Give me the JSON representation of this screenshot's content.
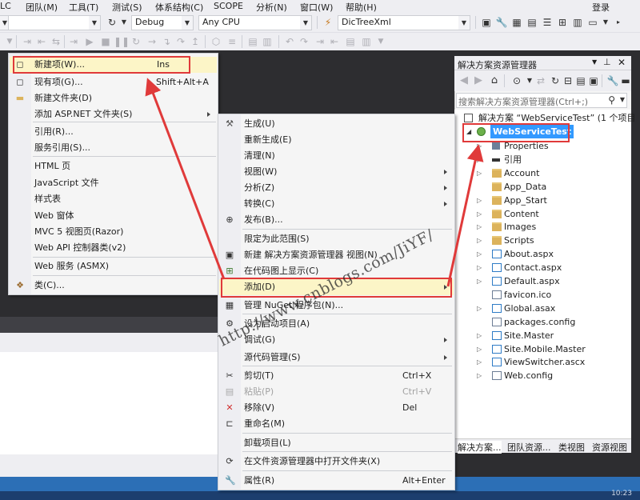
{
  "menubar": {
    "items": [
      "LC",
      "团队(M)",
      "工具(T)",
      "测试(S)",
      "体系结构(C)",
      "SCOPE",
      "分析(N)",
      "窗口(W)",
      "帮助(H)"
    ],
    "signin": "登录"
  },
  "toolbar": {
    "config": "Debug",
    "platform": "Any CPU",
    "startup_target": "DicTreeXml"
  },
  "project_menu": {
    "items": [
      {
        "label": "新建项(W)...",
        "shortcut": "Ins",
        "icon": "new-item-icon"
      },
      {
        "label": "现有项(G)...",
        "shortcut": "Shift+Alt+A",
        "icon": "existing-item-icon"
      },
      {
        "label": "新建文件夹(D)",
        "shortcut": "",
        "icon": "new-folder-icon"
      },
      {
        "label": "添加 ASP.NET 文件夹(S)",
        "shortcut": "",
        "icon": ""
      },
      {
        "label": "引用(R)...",
        "shortcut": "",
        "icon": ""
      },
      {
        "label": "服务引用(S)...",
        "shortcut": "",
        "icon": ""
      },
      {
        "label": "HTML 页",
        "shortcut": "",
        "icon": ""
      },
      {
        "label": "JavaScript 文件",
        "shortcut": "",
        "icon": ""
      },
      {
        "label": "样式表",
        "shortcut": "",
        "icon": ""
      },
      {
        "label": "Web 窗体",
        "shortcut": "",
        "icon": ""
      },
      {
        "label": "MVC 5 视图页(Razor)",
        "shortcut": "",
        "icon": ""
      },
      {
        "label": "Web API 控制器类(v2)",
        "shortcut": "",
        "icon": ""
      },
      {
        "label": "Web 服务 (ASMX)",
        "shortcut": "",
        "icon": ""
      },
      {
        "label": "类(C)...",
        "shortcut": "",
        "icon": "class-icon"
      }
    ]
  },
  "context_menu": {
    "items": [
      {
        "label": "生成(U)",
        "shortcut": ""
      },
      {
        "label": "重新生成(E)",
        "shortcut": ""
      },
      {
        "label": "清理(N)",
        "shortcut": ""
      },
      {
        "label": "视图(W)",
        "shortcut": ""
      },
      {
        "label": "分析(Z)",
        "shortcut": ""
      },
      {
        "label": "转换(C)",
        "shortcut": ""
      },
      {
        "label": "发布(B)...",
        "shortcut": ""
      },
      {
        "label": "限定为此范围(S)",
        "shortcut": ""
      },
      {
        "label": "新建 解决方案资源管理器 视图(N)",
        "shortcut": ""
      },
      {
        "label": "在代码图上显示(C)",
        "shortcut": ""
      },
      {
        "label": "添加(D)",
        "shortcut": ""
      },
      {
        "label": "管理 NuGet 程序包(N)...",
        "shortcut": ""
      },
      {
        "label": "设为启动项目(A)",
        "shortcut": ""
      },
      {
        "label": "调试(G)",
        "shortcut": ""
      },
      {
        "label": "源代码管理(S)",
        "shortcut": ""
      },
      {
        "label": "剪切(T)",
        "shortcut": "Ctrl+X"
      },
      {
        "label": "粘贴(P)",
        "shortcut": "Ctrl+V"
      },
      {
        "label": "移除(V)",
        "shortcut": "Del"
      },
      {
        "label": "重命名(M)",
        "shortcut": ""
      },
      {
        "label": "卸载项目(L)",
        "shortcut": ""
      },
      {
        "label": "在文件资源管理器中打开文件夹(X)",
        "shortcut": ""
      },
      {
        "label": "属性(R)",
        "shortcut": "Alt+Enter"
      }
    ]
  },
  "solution_explorer": {
    "title": "解决方案资源管理器",
    "search_placeholder": "搜索解决方案资源管理器(Ctrl+;)",
    "solution_label": "解决方案 “WebServiceTest” (1 个项目",
    "project": "WebServiceTest",
    "items": [
      {
        "label": "Properties",
        "kind": "props",
        "expandable": true
      },
      {
        "label": "引用",
        "kind": "refs",
        "expandable": true
      },
      {
        "label": "Account",
        "kind": "folder",
        "expandable": true
      },
      {
        "label": "App_Data",
        "kind": "folder",
        "expandable": false
      },
      {
        "label": "App_Start",
        "kind": "folder",
        "expandable": true
      },
      {
        "label": "Content",
        "kind": "folder",
        "expandable": true
      },
      {
        "label": "Images",
        "kind": "folder",
        "expandable": true
      },
      {
        "label": "Scripts",
        "kind": "folder",
        "expandable": true
      },
      {
        "label": "About.aspx",
        "kind": "page",
        "expandable": true
      },
      {
        "label": "Contact.aspx",
        "kind": "page",
        "expandable": true
      },
      {
        "label": "Default.aspx",
        "kind": "page",
        "expandable": true
      },
      {
        "label": "favicon.ico",
        "kind": "file",
        "expandable": false
      },
      {
        "label": "Global.asax",
        "kind": "page",
        "expandable": true
      },
      {
        "label": "packages.config",
        "kind": "file",
        "expandable": false
      },
      {
        "label": "Site.Master",
        "kind": "page",
        "expandable": true
      },
      {
        "label": "Site.Mobile.Master",
        "kind": "page",
        "expandable": true
      },
      {
        "label": "ViewSwitcher.ascx",
        "kind": "page",
        "expandable": true
      },
      {
        "label": "Web.config",
        "kind": "file",
        "expandable": true
      }
    ],
    "tabs": [
      "解决方案...",
      "团队资源...",
      "类视图",
      "资源视图"
    ]
  },
  "watermark": "http://www.cnblogs.com/JiYF/",
  "status": {
    "clock": "10:23"
  },
  "colors": {
    "accent": "#2c6fb6",
    "highlight_box": "#e03a3a",
    "menu_hover": "#fcf5c7",
    "ide_dark": "#2d2d30"
  }
}
